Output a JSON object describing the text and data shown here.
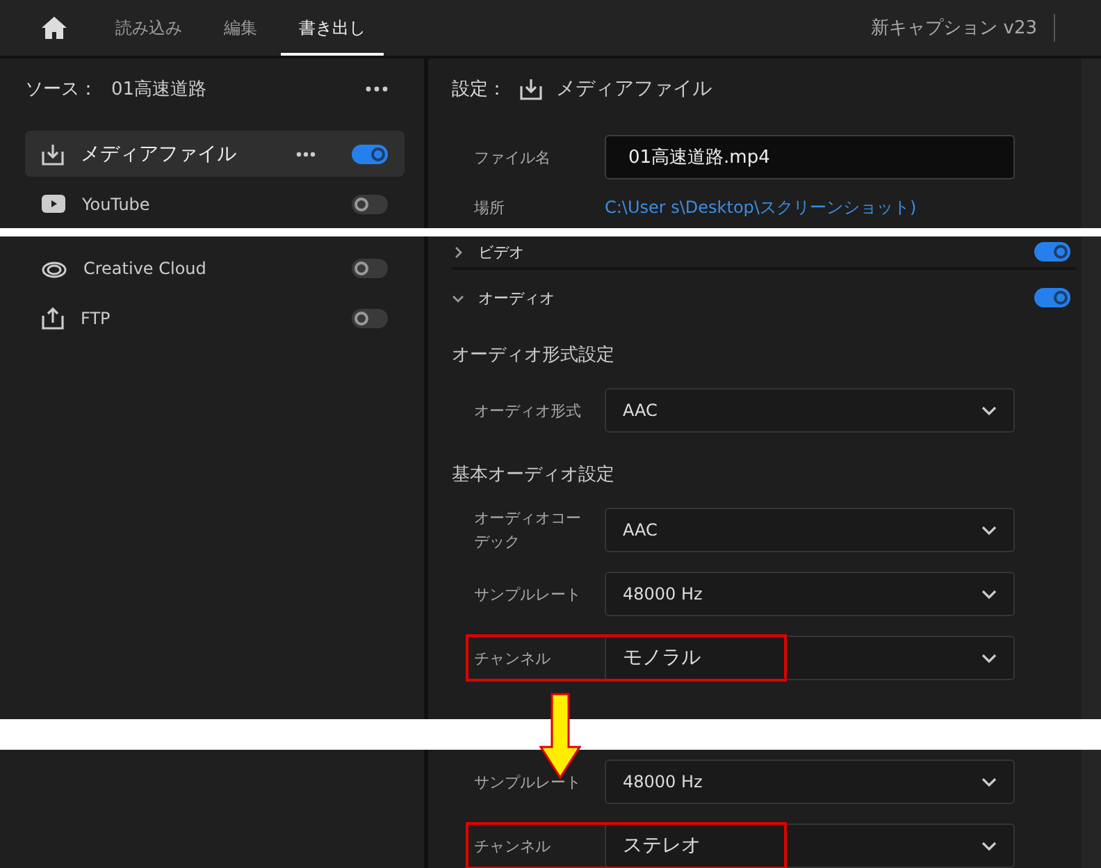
{
  "top_bar": {
    "tabs": [
      {
        "label": "読み込み",
        "selected": false
      },
      {
        "label": "編集",
        "selected": false
      },
      {
        "label": "書き出し",
        "selected": true
      }
    ],
    "project_title": "新キャプション v23"
  },
  "capture_top": {
    "sidebar": {
      "source_label": "ソース：",
      "source_name": "01高速道路",
      "destinations": [
        {
          "name": "メディアファイル",
          "kind": "download",
          "selected": true,
          "on": true,
          "has_menu": true
        },
        {
          "name": "YouTube",
          "kind": "youtube",
          "selected": false,
          "on": false,
          "has_menu": false
        }
      ]
    },
    "settings": {
      "label": "設定：",
      "destination": "メディアファイル",
      "fields": [
        {
          "label": "ファイル名",
          "value": "01高速道路.mp4",
          "kind": "input"
        },
        {
          "label": "場所",
          "value": "C:\\User  s\\Desktop\\スクリーンショット)",
          "kind": "link"
        }
      ]
    }
  },
  "capture_middle": {
    "sidebar": {
      "destinations": [
        {
          "name": "Creative Cloud",
          "kind": "cloud",
          "selected": false,
          "on": false,
          "has_menu": false
        },
        {
          "name": "FTP",
          "kind": "upload",
          "selected": false,
          "on": false,
          "has_menu": false
        }
      ]
    },
    "sections": [
      {
        "title": "ビデオ",
        "expanded": false,
        "on": true
      },
      {
        "title": "オーディオ",
        "expanded": true,
        "on": true
      }
    ],
    "groups": [
      {
        "heading": "オーディオ形式設定",
        "rows": [
          {
            "label": "オーディオ形式",
            "value": "AAC",
            "highlighted": false
          }
        ]
      },
      {
        "heading": "基本オーディオ設定",
        "rows": [
          {
            "label": "オーディオコーデック",
            "value": "AAC",
            "highlighted": false
          },
          {
            "label": "サンプルレート",
            "value": "48000 Hz",
            "highlighted": false
          },
          {
            "label": "チャンネル",
            "value": "モノラル",
            "highlighted": true
          }
        ]
      }
    ]
  },
  "capture_bottom": {
    "rows": [
      {
        "label": "サンプルレート",
        "value": "48000 Hz",
        "highlighted": false
      },
      {
        "label": "チャンネル",
        "value": "ステレオ",
        "highlighted": true
      }
    ]
  }
}
